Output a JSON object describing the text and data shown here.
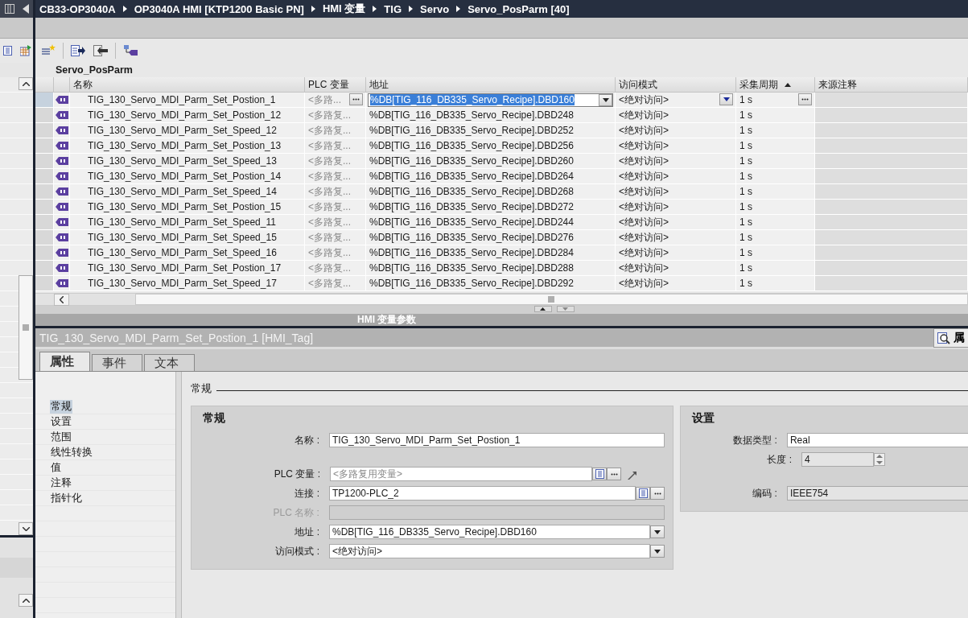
{
  "breadcrumb": [
    "CB33-OP3040A",
    "OP3040A HMI [KTP1200 Basic PN]",
    "HMI 变量",
    "TIG",
    "Servo",
    "Servo_PosParm [40]"
  ],
  "editor": {
    "title": "Servo_PosParm",
    "columns": [
      {
        "label": "名称",
        "sorted": false
      },
      {
        "label": "PLC 变量",
        "sorted": false
      },
      {
        "label": "地址",
        "sorted": false
      },
      {
        "label": "访问模式",
        "sorted": false
      },
      {
        "label": "采集周期",
        "sorted": true
      },
      {
        "label": "来源注释",
        "sorted": false
      }
    ],
    "rows": [
      {
        "name": "TIG_130_Servo_MDI_Parm_Set_Postion_1",
        "plc_tag": "<多路...",
        "address": "%DB[TIG_116_DB335_Servo_Recipe].DBD160",
        "access": "<绝对访问>",
        "cycle": "1 s",
        "selected": true
      },
      {
        "name": "TIG_130_Servo_MDI_Parm_Set_Postion_12",
        "plc_tag": "<多路复...",
        "address": "%DB[TIG_116_DB335_Servo_Recipe].DBD248",
        "access": "<绝对访问>",
        "cycle": "1 s",
        "selected": false
      },
      {
        "name": "TIG_130_Servo_MDI_Parm_Set_Speed_12",
        "plc_tag": "<多路复...",
        "address": "%DB[TIG_116_DB335_Servo_Recipe].DBD252",
        "access": "<绝对访问>",
        "cycle": "1 s",
        "selected": false
      },
      {
        "name": "TIG_130_Servo_MDI_Parm_Set_Postion_13",
        "plc_tag": "<多路复...",
        "address": "%DB[TIG_116_DB335_Servo_Recipe].DBD256",
        "access": "<绝对访问>",
        "cycle": "1 s",
        "selected": false
      },
      {
        "name": "TIG_130_Servo_MDI_Parm_Set_Speed_13",
        "plc_tag": "<多路复...",
        "address": "%DB[TIG_116_DB335_Servo_Recipe].DBD260",
        "access": "<绝对访问>",
        "cycle": "1 s",
        "selected": false
      },
      {
        "name": "TIG_130_Servo_MDI_Parm_Set_Postion_14",
        "plc_tag": "<多路复...",
        "address": "%DB[TIG_116_DB335_Servo_Recipe].DBD264",
        "access": "<绝对访问>",
        "cycle": "1 s",
        "selected": false
      },
      {
        "name": "TIG_130_Servo_MDI_Parm_Set_Speed_14",
        "plc_tag": "<多路复...",
        "address": "%DB[TIG_116_DB335_Servo_Recipe].DBD268",
        "access": "<绝对访问>",
        "cycle": "1 s",
        "selected": false
      },
      {
        "name": "TIG_130_Servo_MDI_Parm_Set_Postion_15",
        "plc_tag": "<多路复...",
        "address": "%DB[TIG_116_DB335_Servo_Recipe].DBD272",
        "access": "<绝对访问>",
        "cycle": "1 s",
        "selected": false
      },
      {
        "name": "TIG_130_Servo_MDI_Parm_Set_Speed_11",
        "plc_tag": "<多路复...",
        "address": "%DB[TIG_116_DB335_Servo_Recipe].DBD244",
        "access": "<绝对访问>",
        "cycle": "1 s",
        "selected": false
      },
      {
        "name": "TIG_130_Servo_MDI_Parm_Set_Speed_15",
        "plc_tag": "<多路复...",
        "address": "%DB[TIG_116_DB335_Servo_Recipe].DBD276",
        "access": "<绝对访问>",
        "cycle": "1 s",
        "selected": false
      },
      {
        "name": "TIG_130_Servo_MDI_Parm_Set_Speed_16",
        "plc_tag": "<多路复...",
        "address": "%DB[TIG_116_DB335_Servo_Recipe].DBD284",
        "access": "<绝对访问>",
        "cycle": "1 s",
        "selected": false
      },
      {
        "name": "TIG_130_Servo_MDI_Parm_Set_Postion_17",
        "plc_tag": "<多路复...",
        "address": "%DB[TIG_116_DB335_Servo_Recipe].DBD288",
        "access": "<绝对访问>",
        "cycle": "1 s",
        "selected": false
      },
      {
        "name": "TIG_130_Servo_MDI_Parm_Set_Speed_17",
        "plc_tag": "<多路复...",
        "address": "%DB[TIG_116_DB335_Servo_Recipe].DBD292",
        "access": "<绝对访问>",
        "cycle": "1 s",
        "selected": false
      }
    ]
  },
  "section_title": "HMI 变量参数",
  "inspector": {
    "title": "TIG_130_Servo_MDI_Parm_Set_Postion_1 [HMI_Tag]",
    "side_tab": "属",
    "tabs": [
      {
        "label": "属性",
        "selected": true
      },
      {
        "label": "事件",
        "selected": false
      },
      {
        "label": "文本",
        "selected": false
      }
    ],
    "nav": [
      {
        "label": "常规",
        "selected": true
      },
      {
        "label": "设置",
        "selected": false
      },
      {
        "label": "范围",
        "selected": false
      },
      {
        "label": "线性转换",
        "selected": false
      },
      {
        "label": "值",
        "selected": false
      },
      {
        "label": "注释",
        "selected": false
      },
      {
        "label": "指针化",
        "selected": false
      }
    ],
    "heading": "常规",
    "panels": [
      {
        "title": "常规",
        "fields": [
          {
            "label": "名称 :",
            "kind": "text",
            "value": "TIG_130_Servo_MDI_Parm_Set_Postion_1",
            "disabled": false
          },
          {
            "label": "PLC 变量 :",
            "kind": "picker_link",
            "placeholder": "<多路复用变量>",
            "disabled": false
          },
          {
            "label": "连接 :",
            "kind": "picker",
            "value": "TP1200-PLC_2",
            "disabled": false
          },
          {
            "label": "PLC 名称 :",
            "kind": "text",
            "disabled": true
          },
          {
            "label": "地址 :",
            "kind": "dropdown",
            "value": "%DB[TIG_116_DB335_Servo_Recipe].DBD160",
            "disabled": false
          },
          {
            "label": "访问模式 :",
            "kind": "dropdown",
            "value": "<绝对访问>",
            "disabled": false
          }
        ]
      },
      {
        "title": "设置",
        "fields": [
          {
            "label": "数据类型 :",
            "kind": "text",
            "value": "Real"
          },
          {
            "label": "长度 :",
            "kind": "spin",
            "value": "4"
          },
          {
            "label": "编码 :",
            "kind": "readonly",
            "value": "IEEE754"
          }
        ]
      }
    ]
  }
}
